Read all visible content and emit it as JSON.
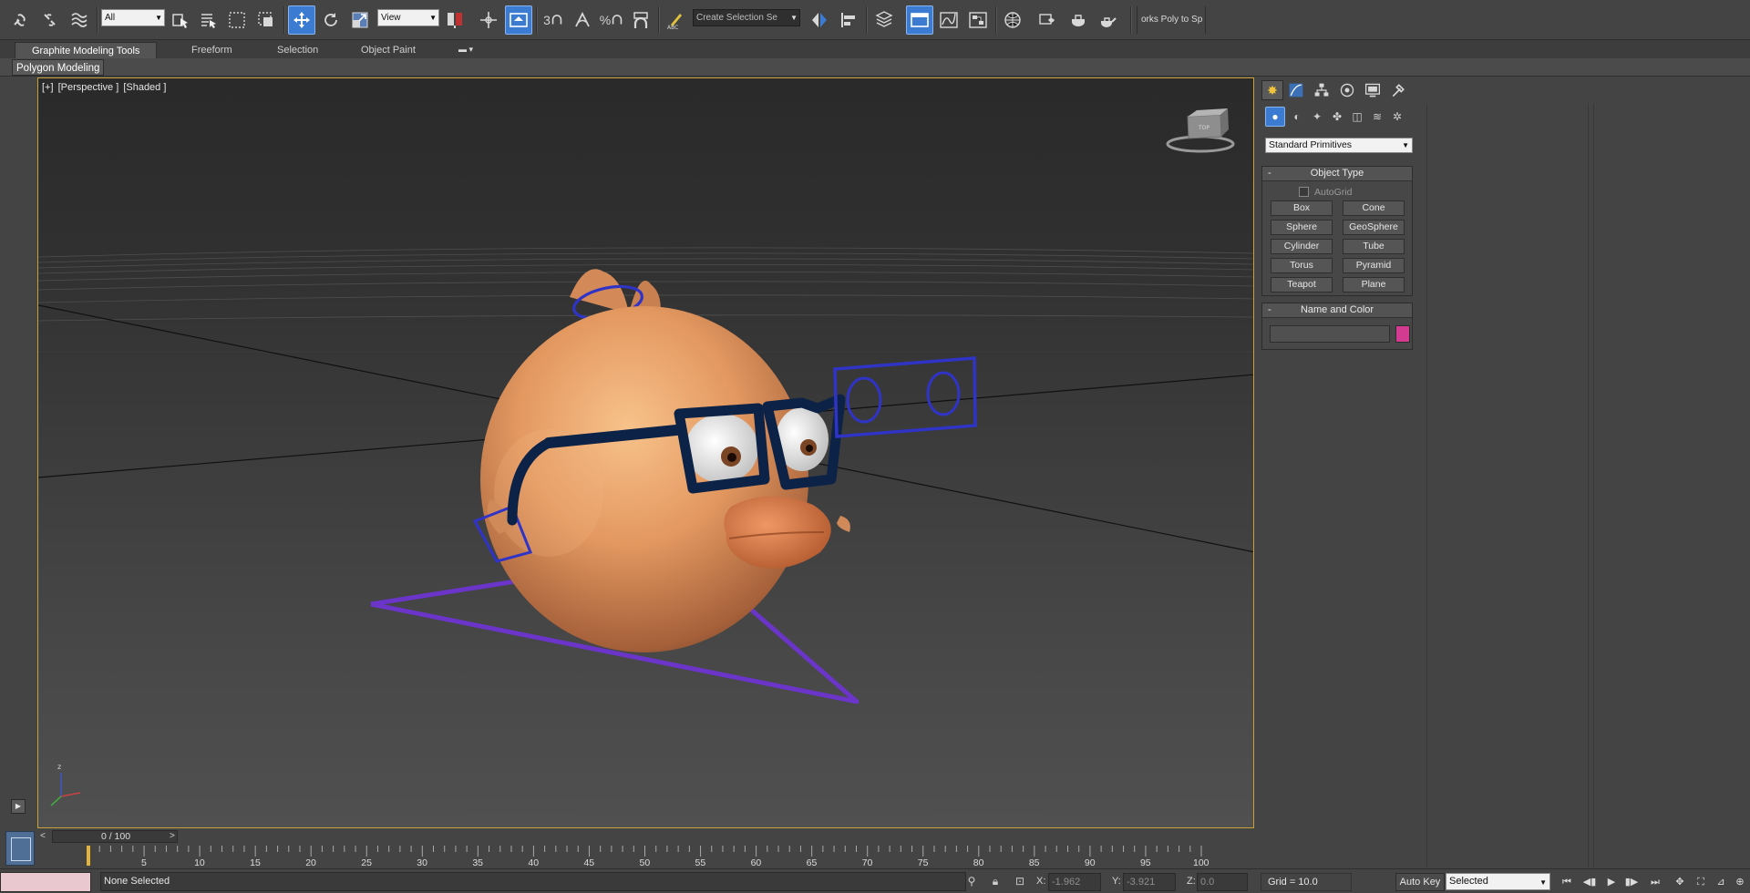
{
  "toolbar": {
    "selection_filter": "All",
    "reference_coordinate": "View",
    "named_selection_placeholder": "Create Selection Se",
    "poly_to_spline": "orks Poly to Sp",
    "snap_labels": {
      "snaps": "3",
      "angle": "",
      "percent": "%",
      "spinner": ""
    }
  },
  "ribbon": {
    "tabs": [
      {
        "label": "Graphite Modeling Tools"
      },
      {
        "label": "Freeform"
      },
      {
        "label": "Selection"
      },
      {
        "label": "Object Paint"
      }
    ],
    "panel_label": "Polygon Modeling"
  },
  "viewport": {
    "label_plus": "[+]",
    "label_view": "[Perspective ]",
    "label_shading": "[Shaded ]",
    "axis_z": "z",
    "viewcube_label": "TOP"
  },
  "command_panel": {
    "tabs": [
      "create-icon",
      "modify-icon",
      "hierarchy-icon",
      "motion-icon",
      "display-icon",
      "utilities-icon"
    ],
    "subtabs": [
      "geometry-icon",
      "shapes-icon",
      "lights-icon",
      "cameras-icon",
      "helpers-icon",
      "spacewarps-icon",
      "systems-icon"
    ],
    "category": "Standard Primitives",
    "object_type": {
      "title": "Object Type",
      "autogrid": "AutoGrid",
      "buttons": [
        "Box",
        "Cone",
        "Sphere",
        "GeoSphere",
        "Cylinder",
        "Tube",
        "Torus",
        "Pyramid",
        "Teapot",
        "Plane"
      ]
    },
    "name_and_color": {
      "title": "Name and Color",
      "name_value": "",
      "color": "#d33b90"
    }
  },
  "timeline": {
    "frame_display": "0 / 100",
    "prev": "<",
    "next": ">",
    "ticks": [
      "5",
      "10",
      "15",
      "20",
      "25",
      "30",
      "35",
      "40",
      "45",
      "50",
      "55",
      "60",
      "65",
      "70",
      "75",
      "80",
      "85",
      "90",
      "95",
      "100"
    ]
  },
  "status": {
    "selection": "None Selected",
    "x_label": "X:",
    "x_value": "-1.962",
    "y_label": "Y:",
    "y_value": "-3.921",
    "z_label": "Z:",
    "z_value": "0.0",
    "grid": "Grid = 10.0",
    "auto_key": "Auto Key",
    "key_filter": "Selected"
  },
  "colors": {
    "accent": "#3b7bd1",
    "viewport_border": "#c7a23a",
    "rig_purple": "#6a35c8",
    "rig_blue": "#2f34c7",
    "character_skin": "#e39860"
  }
}
